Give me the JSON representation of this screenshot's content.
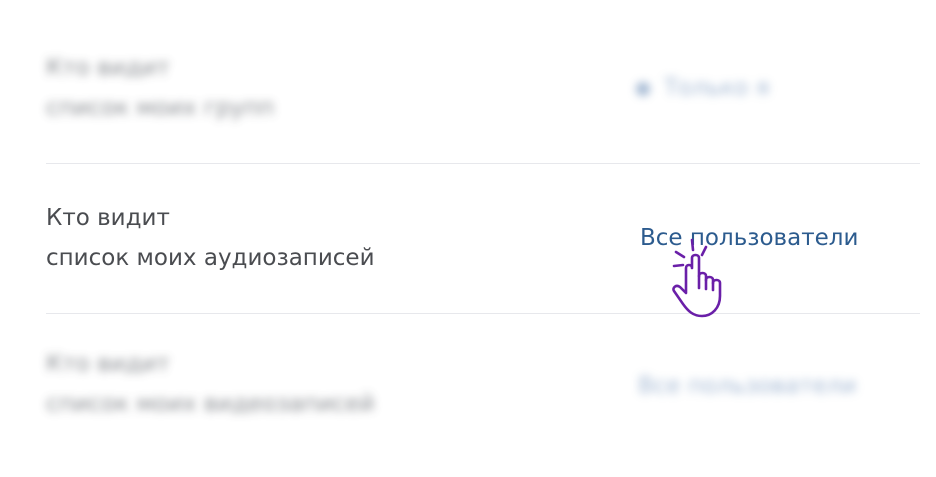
{
  "settings": {
    "rows": [
      {
        "label_line1": "Кто видит",
        "label_line2": "список моих групп",
        "value": "Только я",
        "value_icon": "gear-icon"
      },
      {
        "label_line1": "Кто видит",
        "label_line2": "список моих аудиозаписей",
        "value": "Все пользователи"
      },
      {
        "label_line1": "Кто видит",
        "label_line2": "список моих видеозаписей",
        "value": "Все пользователи"
      }
    ]
  },
  "colors": {
    "link": "#2a5885",
    "label": "#4a4c50",
    "divider": "#e7e8ec",
    "cursor": "#6a1fa8"
  },
  "icons": {
    "cursor": "hand-pointer-icon"
  }
}
